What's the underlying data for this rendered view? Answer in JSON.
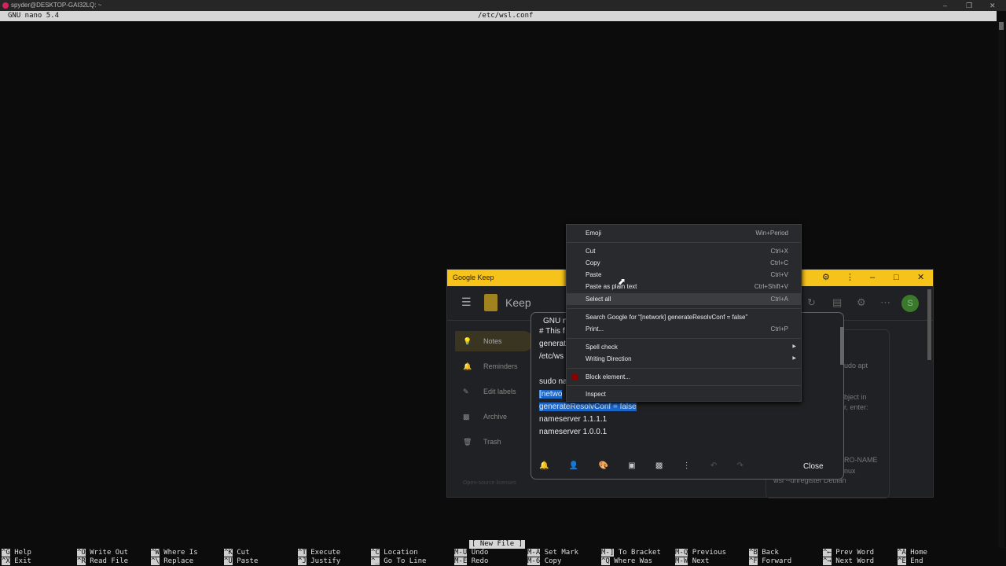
{
  "terminal": {
    "title": "spyder@DESKTOP-GAI32LQ: ~",
    "nano_version": "GNU nano 5.4",
    "filename": "/etc/wsl.conf",
    "status": "[ New File ]",
    "shortcuts": [
      {
        "k1": "^G",
        "l1": "Help",
        "k2": "^X",
        "l2": "Exit"
      },
      {
        "k1": "^O",
        "l1": "Write Out",
        "k2": "^R",
        "l2": "Read File"
      },
      {
        "k1": "^W",
        "l1": "Where Is",
        "k2": "^\\",
        "l2": "Replace"
      },
      {
        "k1": "^K",
        "l1": "Cut",
        "k2": "^U",
        "l2": "Paste"
      },
      {
        "k1": "^T",
        "l1": "Execute",
        "k2": "^J",
        "l2": "Justify"
      },
      {
        "k1": "^C",
        "l1": "Location",
        "k2": "^_",
        "l2": "Go To Line"
      },
      {
        "k1": "M-U",
        "l1": "Undo",
        "k2": "M-E",
        "l2": "Redo"
      },
      {
        "k1": "M-A",
        "l1": "Set Mark",
        "k2": "M-6",
        "l2": "Copy"
      },
      {
        "k1": "M-]",
        "l1": "To Bracket",
        "k2": "^Q",
        "l2": "Where Was"
      },
      {
        "k1": "M-Q",
        "l1": "Previous",
        "k2": "M-W",
        "l2": "Next"
      },
      {
        "k1": "^B",
        "l1": "Back",
        "k2": "^F",
        "l2": "Forward"
      },
      {
        "k1": "^←",
        "l1": "Prev Word",
        "k2": "^→",
        "l2": "Next Word"
      },
      {
        "k1": "^A",
        "l1": "Home",
        "k2": "^E",
        "l2": "End"
      }
    ]
  },
  "keep": {
    "window_title": "Google Keep",
    "app_name": "Keep",
    "avatar": "S",
    "sidebar": [
      "Notes",
      "Reminders",
      "Edit labels",
      "Archive",
      "Trash"
    ],
    "footer": "Open-source licenses",
    "note_lines": [
      "GNU n",
      "# This f",
      "generat",
      "/etc/ws",
      "",
      "sudo na",
      "[netwo",
      "generateResolvConf = false",
      "nameserver 1.1.1.1",
      "nameserver 1.0.0.1"
    ],
    "close_label": "Close",
    "bg_note_lines": [
      "udo apt",
      "bject in",
      "r, enter:",
      "RO-NAME",
      "nux",
      "wsl --unregister Debian"
    ]
  },
  "context_menu": [
    {
      "label": "Emoji",
      "shortcut": "Win+Period"
    },
    {
      "label": "Cut",
      "shortcut": "Ctrl+X"
    },
    {
      "label": "Copy",
      "shortcut": "Ctrl+C"
    },
    {
      "label": "Paste",
      "shortcut": "Ctrl+V"
    },
    {
      "label": "Paste as plain text",
      "shortcut": "Ctrl+Shift+V"
    },
    {
      "label": "Select all",
      "shortcut": "Ctrl+A"
    },
    {
      "label": "Search Google for “[network] generateResolvConf = false”",
      "shortcut": ""
    },
    {
      "label": "Print...",
      "shortcut": "Ctrl+P"
    },
    {
      "label": "Spell check",
      "shortcut": ""
    },
    {
      "label": "Writing Direction",
      "shortcut": ""
    },
    {
      "label": "Block element...",
      "shortcut": ""
    },
    {
      "label": "Inspect",
      "shortcut": ""
    }
  ],
  "colors": {
    "keep_titlebar": "#f6c31a",
    "selection": "#1a66c9",
    "avatar": "#3b7a2a"
  }
}
